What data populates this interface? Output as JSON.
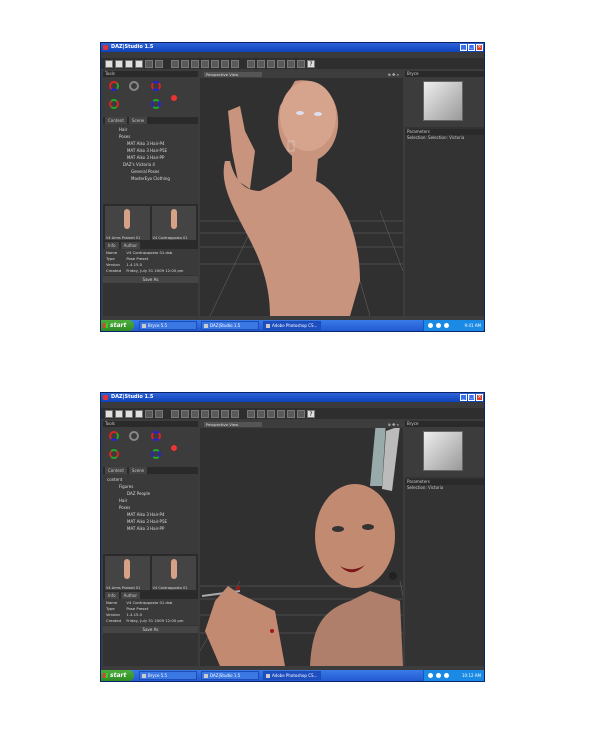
{
  "screens": [
    {
      "window_title": "DAZ|Studio 1.5",
      "menu": [
        "File",
        "Edit",
        "View",
        "Render",
        "Create",
        "Tools",
        "Help"
      ],
      "left_header": "Tools",
      "tabs": [
        "Content",
        "Scene"
      ],
      "tree": [
        "",
        "Hair",
        "Poses",
        "MAT Aiko 3 Hair-P4",
        "MAT Aiko 3 Hair-P5E",
        "MAT Aiko 3 Hair-PP",
        "DAZ's Victoria 4",
        "General Poses",
        "MasterEyo Clothing"
      ],
      "thumb1": "V4 Arms Praised 01",
      "thumb2": "V4 Contrapposto 01",
      "info_tabs": [
        "Info",
        "Author"
      ],
      "info": [
        {
          "k": "Name",
          "v": "V4 Contrapposto 01.dsb"
        },
        {
          "k": "Type",
          "v": "Pose Preset"
        },
        {
          "k": "Version",
          "v": "1.4.15.0"
        },
        {
          "k": "Created",
          "v": "Friday, July 31 2009 12:00 pm"
        }
      ],
      "save_as": "Save As",
      "viewport_camera": "Perspective View",
      "right_header": "Bryce",
      "params_header": "Parameters",
      "params_sub": "Selection: Selection: Victoria",
      "start_label": "start",
      "tasks": [
        "Bryce 5.5",
        "DAZ|Studio 1.5",
        "Adobe Photoshop CS..."
      ],
      "clock": "9:41 AM"
    },
    {
      "window_title": "DAZ|Studio 1.5",
      "menu": [
        "File",
        "Edit",
        "View",
        "Render",
        "Create",
        "Tools",
        "Help"
      ],
      "left_header": "Tools",
      "tabs": [
        "Content",
        "Scene"
      ],
      "tree": [
        "content",
        "Figures",
        "DAZ People",
        "Hair",
        "Poses",
        "MAT Aiko 3 Hair-P4",
        "MAT Aiko 3 Hair-P5E",
        "MAT Aiko 3 Hair-PP"
      ],
      "thumb1": "V4 Arms Praised 01",
      "thumb2": "V4 Contrapposto 01",
      "info_tabs": [
        "Info",
        "Author"
      ],
      "info": [
        {
          "k": "Name",
          "v": "V4 Contrapposto 01.dsb"
        },
        {
          "k": "Type",
          "v": "Pose Preset"
        },
        {
          "k": "Version",
          "v": "1.4.15.0"
        },
        {
          "k": "Created",
          "v": "Friday, July 31 2009 12:00 pm"
        }
      ],
      "save_as": "Save As",
      "viewport_camera": "Perspective View",
      "right_header": "Bryce",
      "params_header": "Parameters",
      "params_sub": "Selection: Victoria",
      "start_label": "start",
      "tasks": [
        "Bryce 5.5",
        "DAZ|Studio 1.5",
        "Adobe Photoshop CS..."
      ],
      "clock": "10:12 AM"
    }
  ],
  "colors": {
    "skin": "#c8947e",
    "window_bg": "#3c3c3c",
    "taskbar": "#225ad2",
    "start": "#2e8b22"
  }
}
